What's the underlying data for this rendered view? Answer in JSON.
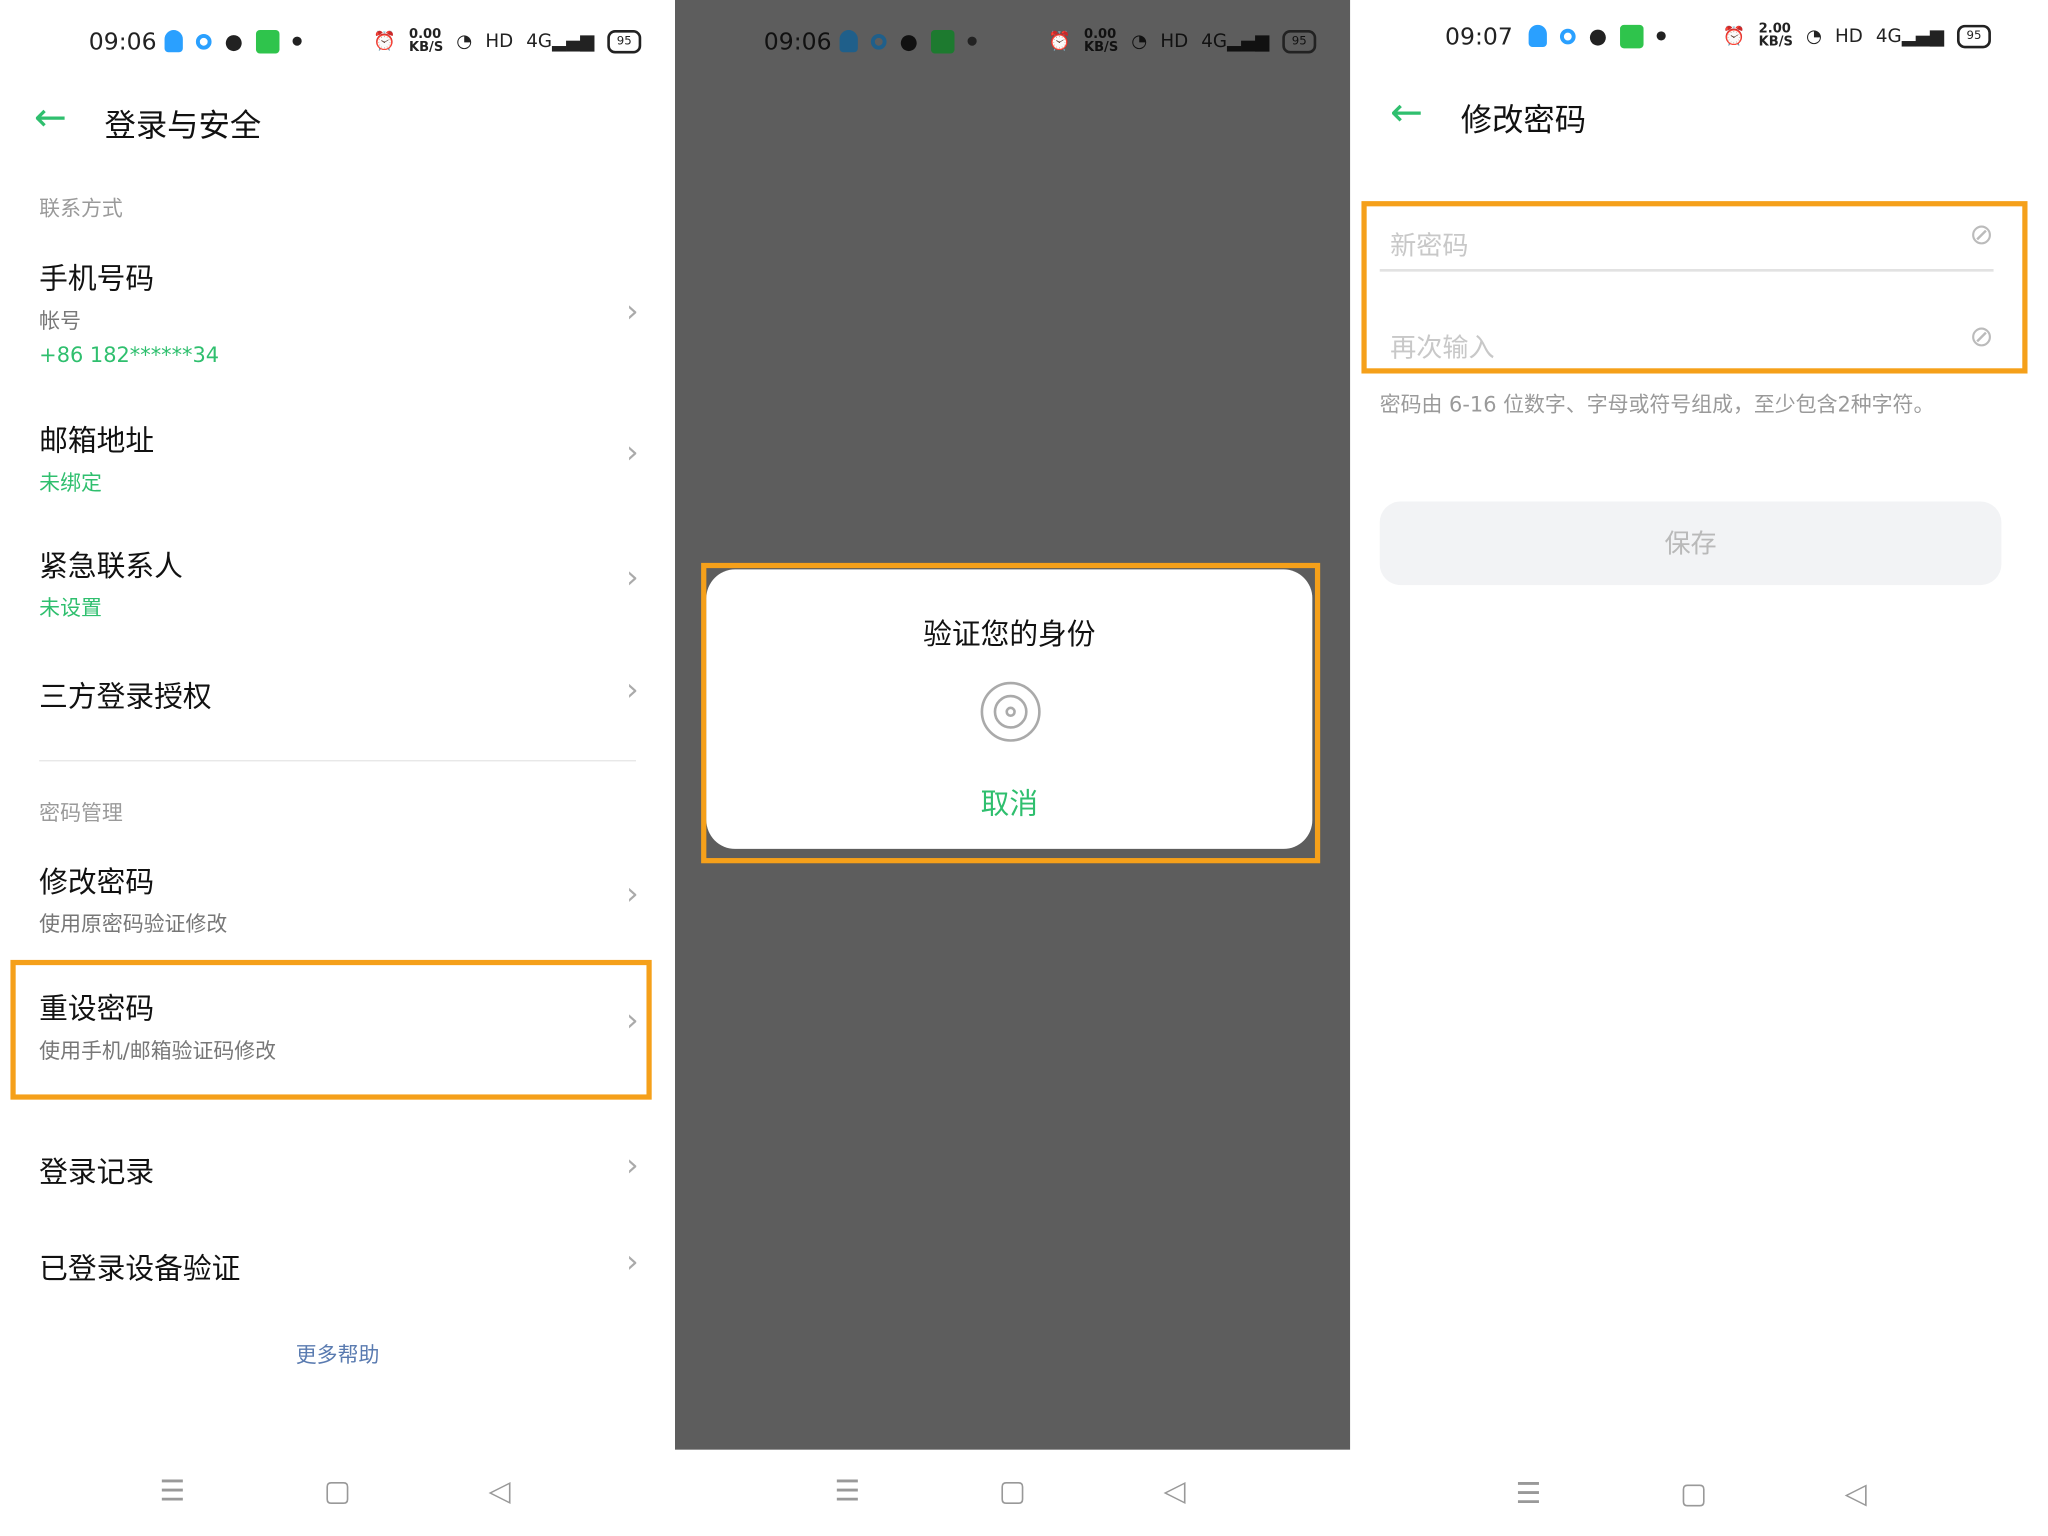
{
  "status": {
    "time1": "09:06",
    "time2": "09:06",
    "time3": "09:07",
    "net1": "0.00",
    "net2": "0.00",
    "net3": "2.00",
    "netunit": "KB/S",
    "hd": "HD",
    "sig": "4G",
    "battery": "95"
  },
  "screen1": {
    "title": "登录与安全",
    "section1": "联系方式",
    "phone_title": "手机号码",
    "phone_sub": "帐号",
    "phone_num": "+86 182******34",
    "email_title": "邮箱地址",
    "email_status": "未绑定",
    "emergency_title": "紧急联系人",
    "emergency_status": "未设置",
    "thirdparty_title": "三方登录授权",
    "section2": "密码管理",
    "change_title": "修改密码",
    "change_sub": "使用原密码验证修改",
    "reset_title": "重设密码",
    "reset_sub": "使用手机/邮箱验证码修改",
    "login_record": "登录记录",
    "device_verify": "已登录设备验证",
    "more_help": "更多帮助"
  },
  "screen2": {
    "dialog_title": "验证您的身份",
    "cancel": "取消"
  },
  "screen3": {
    "title": "修改密码",
    "new_pwd_ph": "新密码",
    "confirm_ph": "再次输入",
    "hint": "密码由 6-16 位数字、字母或符号组成，至少包含2种字符。",
    "save": "保存"
  },
  "colors": {
    "accent": "#2fbf6e",
    "highlight": "#f5a01a"
  }
}
